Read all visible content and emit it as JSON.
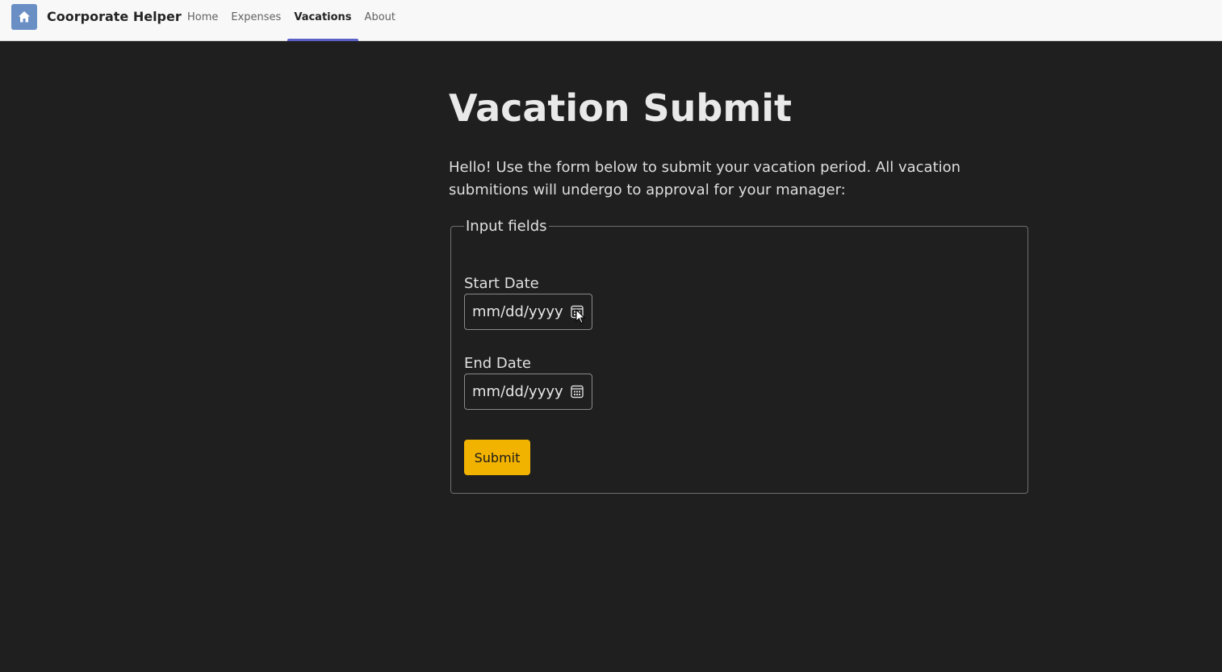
{
  "app": {
    "title": "Coorporate Helper",
    "icon": "home-icon",
    "icon_color": "#6a8fc4"
  },
  "nav": {
    "tabs": [
      {
        "label": "Home",
        "active": false
      },
      {
        "label": "Expenses",
        "active": false
      },
      {
        "label": "Vacations",
        "active": true
      },
      {
        "label": "About",
        "active": false
      }
    ],
    "active_color": "#5b5fc7"
  },
  "main": {
    "title": "Vacation Submit",
    "intro": "Hello! Use the form below to submit your vacation period. All vacation submitions will undergo to approval for your manager:"
  },
  "form": {
    "legend": "Input fields",
    "start_date": {
      "label": "Start Date",
      "placeholder": "mm/dd/yyyy",
      "icon": "calendar-icon"
    },
    "end_date": {
      "label": "End Date",
      "placeholder": "mm/dd/yyyy",
      "icon": "calendar-icon"
    },
    "submit_label": "Submit",
    "submit_color": "#f2b200"
  },
  "colors": {
    "background": "#1f1f1f",
    "topbar": "#f8f8f8"
  }
}
